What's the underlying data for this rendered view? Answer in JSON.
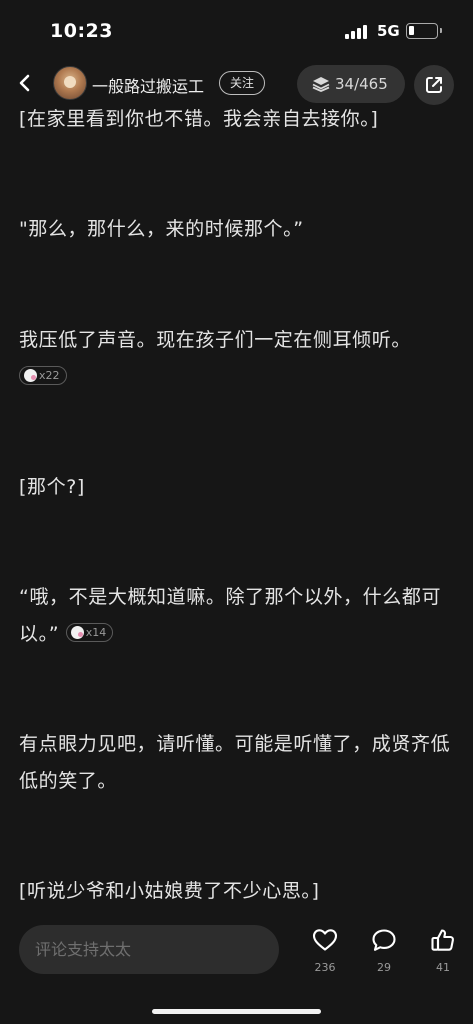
{
  "status_bar": {
    "time": "10:23",
    "network": "5G",
    "battery_level": 0.2
  },
  "header": {
    "author_name": "一般路过搬运工",
    "follow_label": "关注",
    "chapter_progress": "34/465",
    "back_icon": "chevron-left-icon",
    "share_icon": "share-icon"
  },
  "content": {
    "paragraphs": [
      {
        "text": "[在家里看到你也不错。我会亲自去接你。]",
        "reaction_count": ""
      },
      {
        "text": "\"那么，那什么，来的时候那个。”",
        "reaction_count": ""
      },
      {
        "text": "我压低了声音。现在孩子们一定在侧耳倾听。",
        "reaction_count": "x22"
      },
      {
        "text": "[那个?]",
        "reaction_count": ""
      },
      {
        "text": "“哦，不是大概知道嘛。除了那个以外，什么都可以。”",
        "reaction_count": "x14"
      },
      {
        "text": "有点眼力见吧，请听懂。可能是听懂了，成贤齐低低的笑了。",
        "reaction_count": ""
      },
      {
        "text": "[听说少爷和小姑娘费了不少心思。]",
        "reaction_count": ""
      }
    ]
  },
  "bottom_bar": {
    "comment_placeholder": "评论支持太太",
    "like_count": "236",
    "comment_count": "29",
    "thumbs_count": "41"
  },
  "colors": {
    "background": "#161616",
    "text": "#e4e4e4",
    "pill_background": "#333333"
  }
}
